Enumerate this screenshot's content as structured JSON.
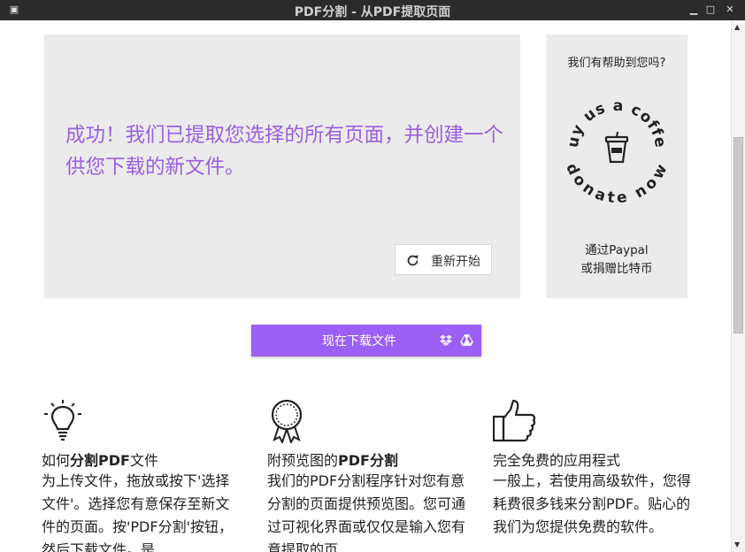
{
  "window": {
    "title": "PDF分割 - 从PDF提取页面"
  },
  "success": {
    "message": "成功！我们已提取您选择的所有页面，并创建一个供您下载的新文件。",
    "restart_label": "重新开始"
  },
  "coffee": {
    "question": "我们有帮助到您吗?",
    "badge_top": "buy us a coffee",
    "badge_bottom": "donate now",
    "paypal_line1": "通过Paypal",
    "paypal_line2": "或捐赠比特币"
  },
  "download": {
    "label": "现在下载文件",
    "icons": [
      "dropbox-icon",
      "google-drive-icon"
    ]
  },
  "features": [
    {
      "title_pre": "如何",
      "title_bold": "分割PDF",
      "title_post": "文件",
      "body": "为上传文件，拖放或按下'选择文件'。选择您有意保存至新文件的页面。按'PDF分割'按钮，然后下载文件。是"
    },
    {
      "title_pre": "附预览图的",
      "title_bold": "PDF分割",
      "title_post": "",
      "body": "我们的PDF分割程序针对您有意分割的页面提供预览图。您可通过可视化界面或仅仅是输入您有意提取的页"
    },
    {
      "title_pre": "完全免费的应用程式",
      "title_bold": "",
      "title_post": "",
      "body": "一般上，若使用高级软件，您得耗费很多钱来分割PDF。贴心的我们为您提供免费的软件。"
    }
  ],
  "colors": {
    "accent": "#9b5ff5",
    "panel": "#ebebeb",
    "titlebar": "#2b2b2b"
  }
}
